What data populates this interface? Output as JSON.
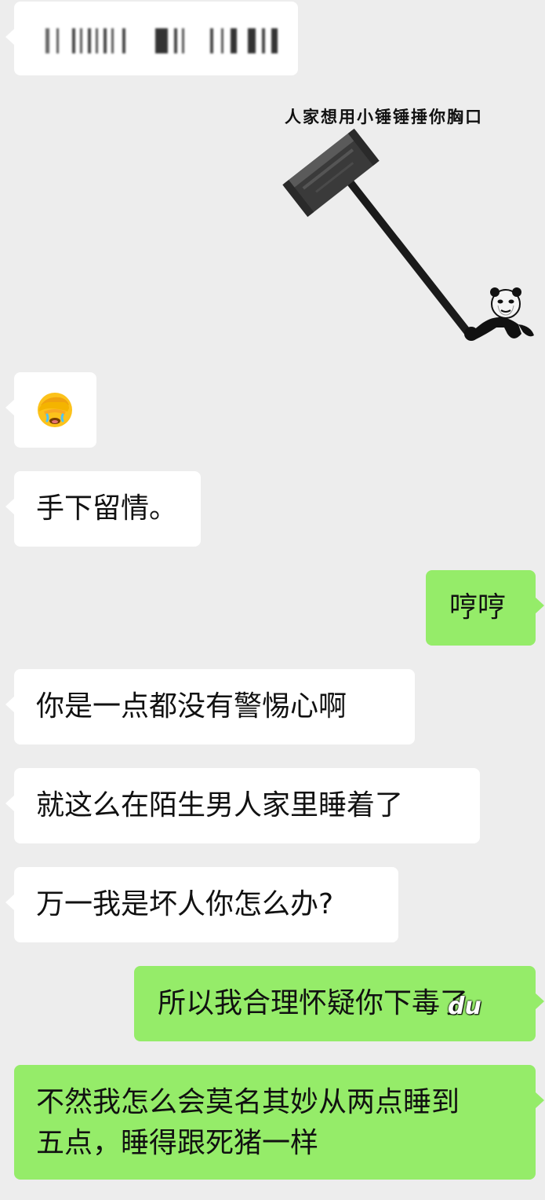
{
  "messages": [
    {
      "id": "m1",
      "side": "left",
      "type": "blurred"
    },
    {
      "id": "m2",
      "side": "left",
      "type": "sticker",
      "caption": "人家想用小锤锤捶你胸口"
    },
    {
      "id": "m3",
      "side": "left",
      "type": "emoji",
      "emoji": "facepalm-crying"
    },
    {
      "id": "m4",
      "side": "left",
      "text": "手下留情。"
    },
    {
      "id": "m5",
      "side": "right",
      "text": "哼哼"
    },
    {
      "id": "m6",
      "side": "left",
      "text": "你是一点都没有警惕心啊"
    },
    {
      "id": "m7",
      "side": "left",
      "text": "就这么在陌生男人家里睡着了"
    },
    {
      "id": "m8",
      "side": "left",
      "text": "万一我是坏人你怎么办?"
    },
    {
      "id": "m9",
      "side": "right",
      "text": "所以我合理怀疑你下毒了"
    },
    {
      "id": "m10",
      "side": "right",
      "text_line1": "不然我怎么会莫名其妙从两点睡到",
      "text_line2": "五点，睡得跟死猪一样"
    }
  ],
  "watermark": "du",
  "colors": {
    "background": "#ededed",
    "incoming_bubble": "#ffffff",
    "outgoing_bubble": "#95ec69"
  }
}
